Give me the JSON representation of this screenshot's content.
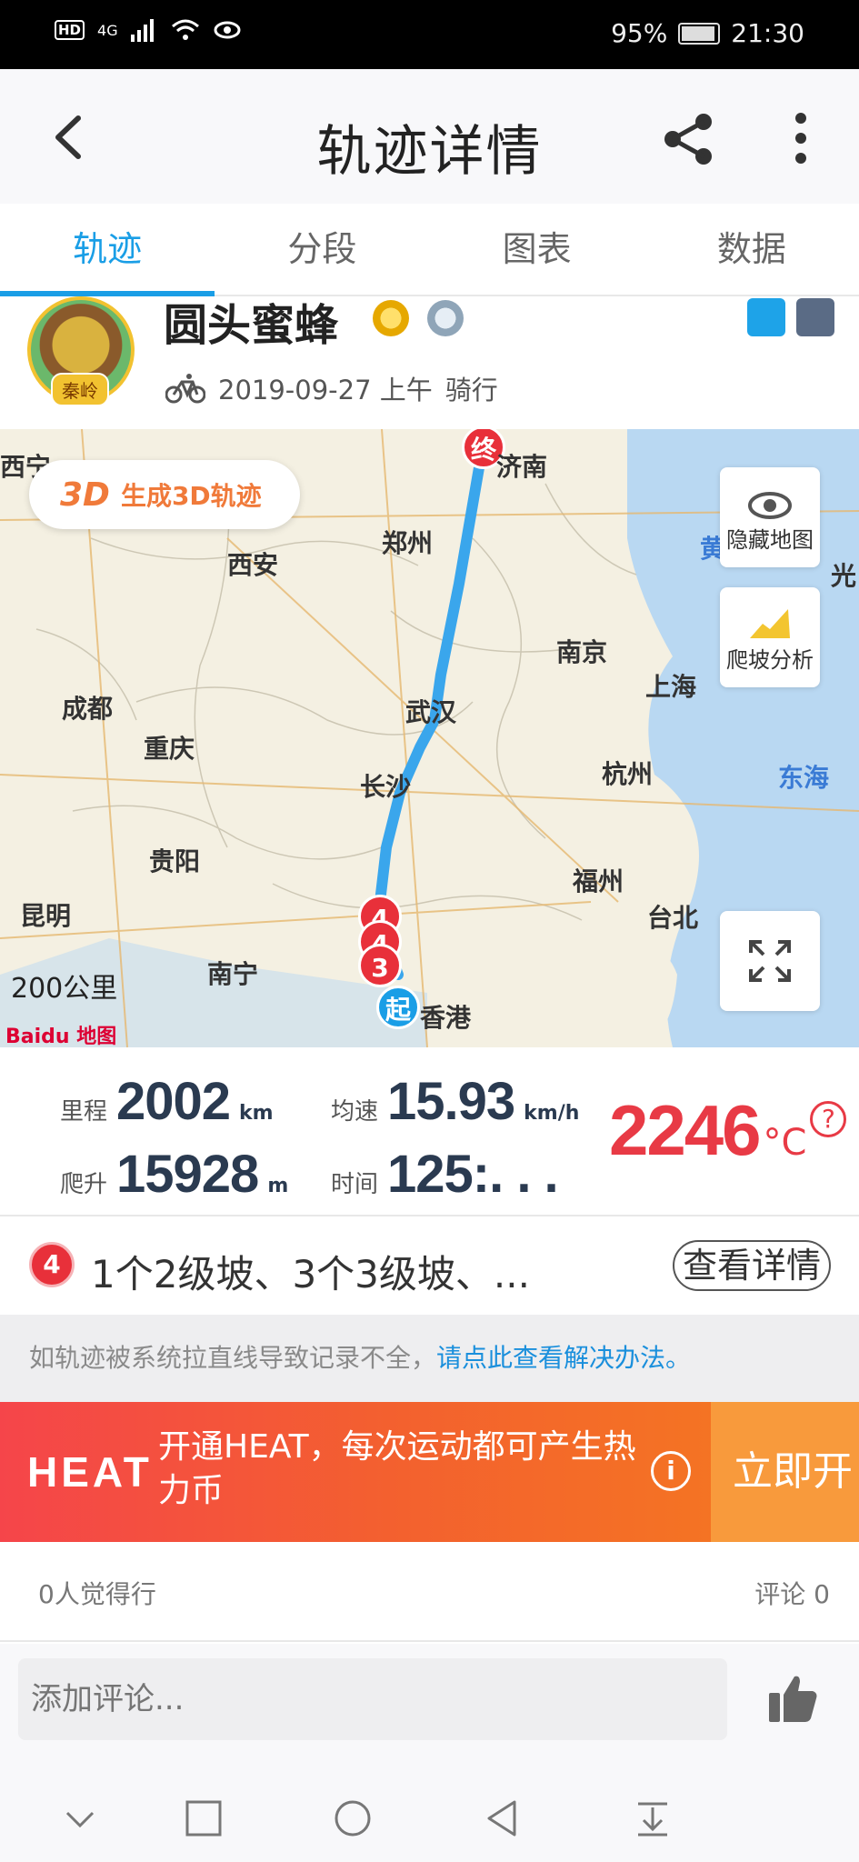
{
  "status_bar": {
    "left_badges": [
      "HD",
      "4G"
    ],
    "battery_text": "95%",
    "time": "21:30"
  },
  "header": {
    "title": "轨迹详情"
  },
  "tabs": [
    {
      "label": "轨迹",
      "active": true
    },
    {
      "label": "分段",
      "active": false
    },
    {
      "label": "图表",
      "active": false
    },
    {
      "label": "数据",
      "active": false
    }
  ],
  "profile": {
    "username": "圆头蜜蜂",
    "avatar_tag": "秦岭",
    "datetime": "2019-09-27 上午",
    "activity": "骑行"
  },
  "map": {
    "generate_3d_icon": "3D",
    "generate_3d_label": "生成3D轨迹",
    "hide_map_label": "隐藏地图",
    "climb_analysis_label": "爬坡分析",
    "scale_text": "200公里",
    "logo_text": "Baidu 地图",
    "start_marker": "起",
    "end_marker": "终",
    "segment_markers": [
      "4",
      "4",
      "3"
    ],
    "cities": [
      {
        "name": "西宁"
      },
      {
        "name": "济南"
      },
      {
        "name": "郑州"
      },
      {
        "name": "西安"
      },
      {
        "name": "南京"
      },
      {
        "name": "上海"
      },
      {
        "name": "成都"
      },
      {
        "name": "武汉"
      },
      {
        "name": "重庆"
      },
      {
        "name": "杭州"
      },
      {
        "name": "东海"
      },
      {
        "name": "长沙"
      },
      {
        "name": "贵阳"
      },
      {
        "name": "福州"
      },
      {
        "name": "昆明"
      },
      {
        "name": "台北"
      },
      {
        "name": "南宁"
      },
      {
        "name": "香港"
      },
      {
        "name": "黄"
      },
      {
        "name": "光"
      }
    ]
  },
  "stats": {
    "distance": {
      "label": "里程",
      "value": "2002",
      "unit": "km"
    },
    "avg_speed": {
      "label": "均速",
      "value": "15.93",
      "unit": "km/h"
    },
    "climb": {
      "label": "爬升",
      "value": "15928",
      "unit": "m"
    },
    "time": {
      "label": "时间",
      "value": "125:. . ."
    },
    "calories": {
      "value": "2246",
      "unit": "°C",
      "help": "?"
    }
  },
  "climb_summary": {
    "badge": "4",
    "text": "1个2级坡、3个3级坡、...",
    "detail_button": "查看详情"
  },
  "notice": {
    "text": "如轨迹被系统拉直线导致记录不全，",
    "link": "请点此查看解决办法。"
  },
  "heat_banner": {
    "logo": "HEAT",
    "message": "开通HEAT，每次运动都可产生热力币",
    "info": "i",
    "cta": "立即开"
  },
  "social": {
    "likes_text": "0人觉得行",
    "comments_text": "评论 0"
  },
  "comment_bar": {
    "placeholder": "添加评论..."
  },
  "colors": {
    "accent": "#1a9ee6",
    "route": "#3aa6ec",
    "calorie_red": "#e83a45",
    "heat_orange": "#f57c1e"
  }
}
